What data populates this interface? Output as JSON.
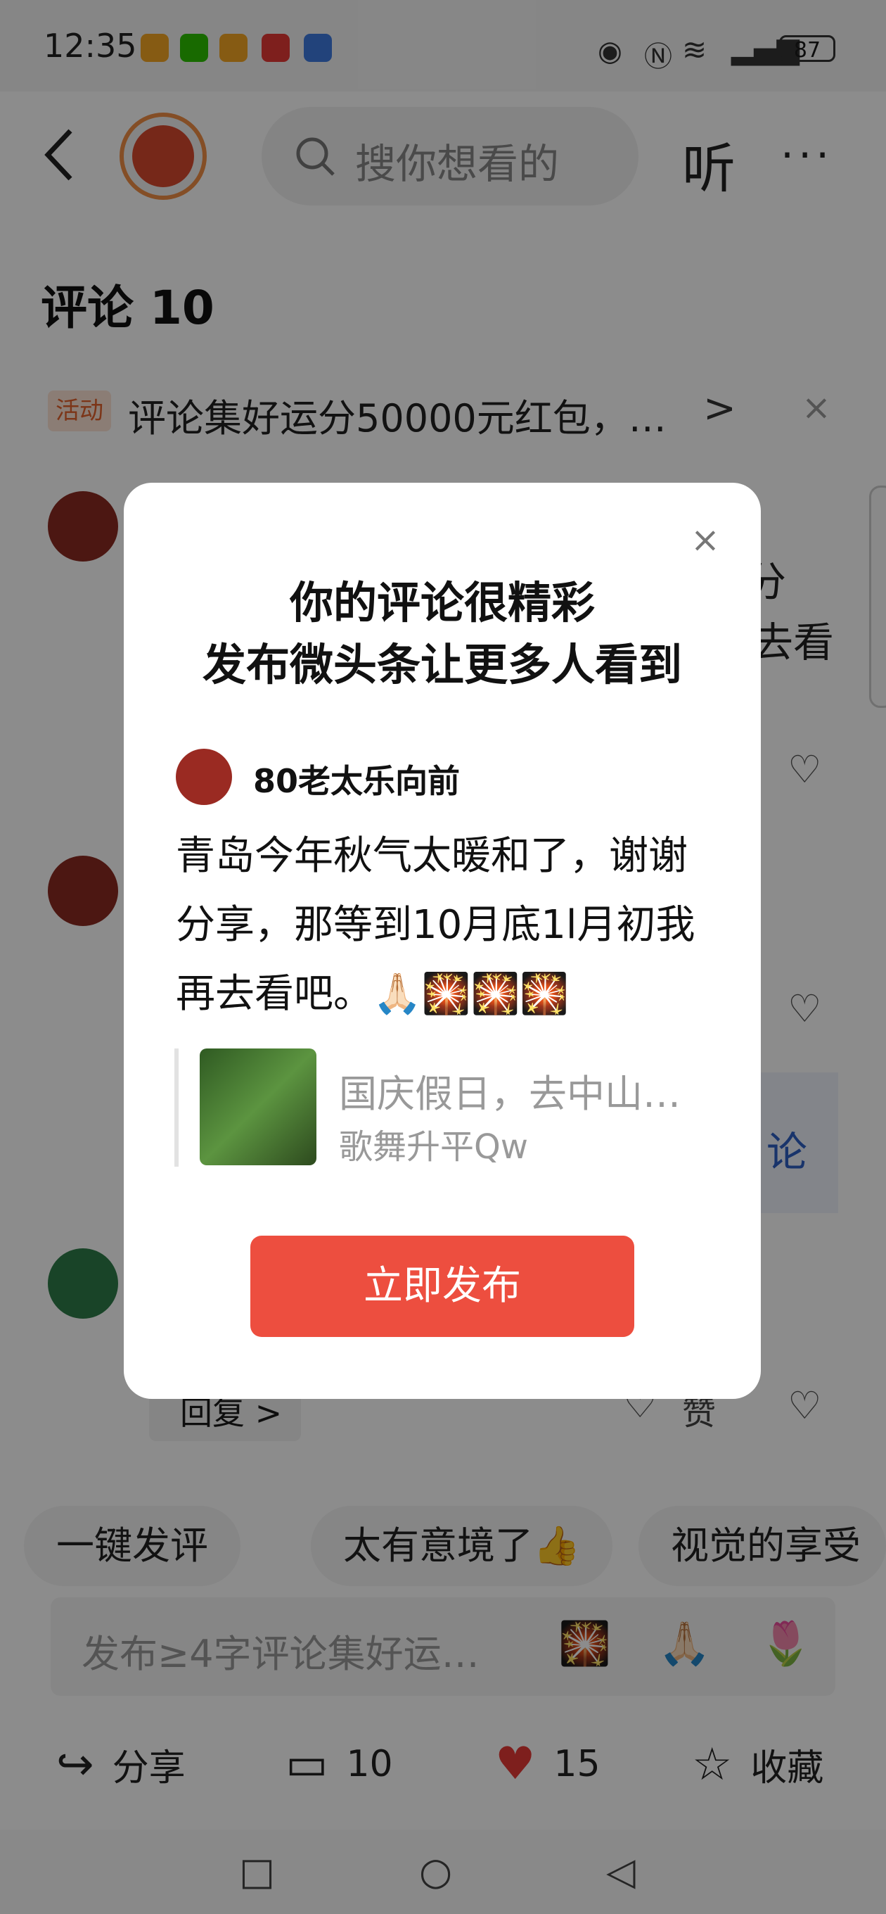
{
  "status_bar": {
    "time": "12:35",
    "battery": "87"
  },
  "header": {
    "search_placeholder": "搜你想看的",
    "listen_label": "听",
    "more_label": "···"
  },
  "comments": {
    "title": "评论 10",
    "banner": {
      "tag": "活动",
      "text": "评论集好运分50000元红包，…",
      "arrow": ">",
      "close": "×"
    },
    "bg_fragments": {
      "f1": "分",
      "f2": "去看",
      "f3": "论"
    },
    "reply_label": "回复 >",
    "like_label": "赞"
  },
  "quick_replies": [
    "一键发评",
    "太有意境了👍",
    "视觉的享受"
  ],
  "input": {
    "placeholder": "发布≥4字评论集好运…",
    "emojis": [
      "🎇",
      "🙏🏻",
      "🌷"
    ]
  },
  "toolbar": {
    "share_label": "分享",
    "comment_count": "10",
    "like_count": "15",
    "favorite_label": "收藏"
  },
  "dialog": {
    "title_line1": "你的评论很精彩",
    "title_line2": "发布微头条让更多人看到",
    "username": "80老太乐向前",
    "body": "青岛今年秋气太暖和了，谢谢分享，那等到10月底1l月初我再去看吧。🙏🏻🎇🎇🎇",
    "quote_title": "国庆假日，去中山…",
    "quote_author": "歌舞升平Qw",
    "cta_label": "立即发布",
    "close_label": "×"
  },
  "colors": {
    "accent": "#ed4e3f",
    "tag_bg": "#fde4d6",
    "tag_text": "#e2622d"
  }
}
